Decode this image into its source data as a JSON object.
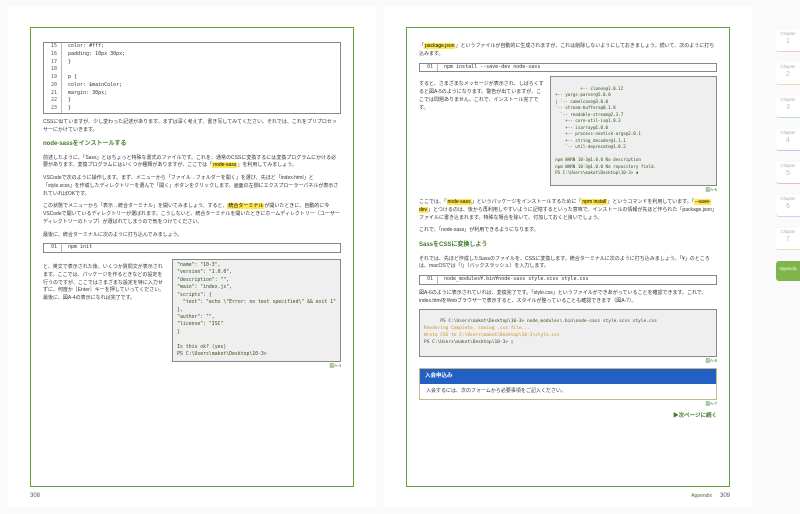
{
  "leftCode": {
    "lines": [
      {
        "n": "15",
        "c": "    color: #fff;"
      },
      {
        "n": "16",
        "c": "    padding: 10px 30px;"
      },
      {
        "n": "17",
        "c": "}"
      },
      {
        "n": "18",
        "c": ""
      },
      {
        "n": "19",
        "c": "p {"
      },
      {
        "n": "20",
        "c": "    color: $mainColor;"
      },
      {
        "n": "21",
        "c": "    margin: 30px;"
      },
      {
        "n": "22",
        "c": "}"
      },
      {
        "n": "23",
        "c": "}"
      }
    ]
  },
  "leftIntro": "CSSに似ていますが、少し変わった記述があります。まずは深く考えず、書き写してみてください。それでは、これをプリプロセッサーにかけていきます。",
  "leftH1": "node-sassをインストールする",
  "leftP1a": "前述したように、「Sass」とはちょっと特殊な書式のファイルです。これを、通常のCSSに変換するには変換プログラムにかける必要があります。変換プログラムにはいくつか種類がありますが、ここでは「",
  "leftP1hl": "node-sass",
  "leftP1b": "」を利用してみましょう。",
  "leftP2": "VSCodeで次のように操作します。まず、メニューから「ファイル→フォルダーを開く」を選び、先ほど「index.html」と「style.scss」を作成したディレクトリーを選んで「開く」ボタンをクリックします。画面の左側にエクスプローラーパネルが表示されていればOKです。",
  "leftP3a": "この状態でメニューから「表示→統合ターミナル」を開いてみましょう。すると、",
  "leftP3hl": "統合ターミナル",
  "leftP3b": "が開いたときに、自動的に今VSCodeで開いているディレクトリーが選ばれます。こうしないと、統合ターミナルを開いたときにホームディレクトリー（ユーザーディレクトリーのトップ）が選ばれてしまうので気をつけてください。",
  "leftP4": "最後に、統合ターミナルに次のように打ち込んでみましょう。",
  "leftCmd1": {
    "n": "01",
    "c": "npm init"
  },
  "leftBottom": "と、英文で表示された後、いくつか質問文が表示されます。ここでは、パッケージを作るときなどの設定を行うのですが、ここではさまざまな設定を特に入力せずに、何度か［Enter］キーを押していってください。\n最後に、図A-4の表示になれば完了です。",
  "leftTerm": "\"name\": \"10-3\",\n\"version\": \"1.0.0\",\n\"description\": \"\",\n\"main\": \"index.js\",\n\"scripts\": {\n  \"test\": \"echo \\\"Error: no test specified\\\" && exit 1\"\n},\n\"author\": \"\",\n\"license\": \"ISC\"\n}\n\nIs this ok? (yes)\nPS C:\\Users\\makot\\Desktop\\10-3>",
  "leftFig": "図A-4",
  "pageL": "308",
  "rightP0a": "「",
  "rightP0hl": "package.json",
  "rightP0b": "」というファイルが自動的に生成されますが、これは削除しないようにしておきましょう。続いて、次のように打ち込みます。",
  "rightCmd1": {
    "n": "01",
    "c": "npm install --save-dev node-sass"
  },
  "rightSide1": "すると、さまざまなメッセージが表示され、しばらくすると図A-5のようになります。警告が出ていますが、ここでは問題ありません。これで、インストール完了です。",
  "rightTerm1": "+-- clones@1.0.12\n+-- yargs-parser@5.0.0\n| `-- camelcase@3.0.0\n`-- stream-buffers@0.1.8\n  `-- readable-stream@2.3.7\n    +-- core-util-is@1.0.3\n    +-- isarray@1.0.0\n    +-- process-nextick-args@2.0.1\n    +-- string_decoder@1.1.1\n    `-- util-deprecate@1.0.2\n\nnpm WARN 10-3@1.0.0 No description\nnpm WARN 10-3@1.0.0 No repository field.\nPS C:\\Users\\makot\\Desktop\\10-3> ▮",
  "rightFig1": "図A-5",
  "rightP1a": "ここでは、「",
  "rightP1hl1": "node-sass",
  "rightP1b": "」というパッケージをインストールするために「",
  "rightP1hl2": "npm install",
  "rightP1c": "」というコマンドを利用しています。「",
  "rightP1hl3": "--save-dev",
  "rightP1d": "」とつけるのは、後から再利用しやすいように記憶するといった意味で、インストールの情報が先ほど作られた「package.json」ファイルに書き込まれます。特殊な場合を除いて、付加しておくと良いでしょう。",
  "rightP1e": "これで、「node-sass」が利用できるようになります。",
  "rightH2": "SassをCSSに変換しよう",
  "rightP2": "それでは、先ほど作成したSassのファイルを、CSSに変換します。統合ターミナルに次のように打ち込みましょう。「¥」のところは、macOSでは「/」（バックスラッシュ）を入力します。",
  "rightCmd2": {
    "n": "01",
    "c": "node_modules¥.bin¥node-sass style.scss style.css"
  },
  "rightP3": "図A-6のように表示されていれば、変換完了です。「style.css」というファイルができあがっていることを確認できます。これで、index.htmlをWebブラウザーで表示すると、スタイルが整っていることも確認できます（図A-7）。",
  "rightTerm2a": "PS C:\\Users\\makot\\Desktop\\10-3> node_modules\\.bin\\node-sass style.scss style.css",
  "rightTerm2b": "Rendering Complete, saving .css file...\nWrote CSS to C:\\Users\\makot\\Desktop\\10-3\\style.css",
  "rightTerm2c": "PS C:\\Users\\makot\\Desktop\\10-3> ▯",
  "rightFig2": "図A-6",
  "signupHead": "入会申込み",
  "signupBody": "入会するには、次のフォームから必要事項をご記入ください。",
  "rightFig3": "図A-7",
  "next": "▶次ページに続く",
  "pageR": "309",
  "appendix": "Appendix",
  "tabs": {
    "t": "Chapter",
    "ap": "Appendix"
  }
}
